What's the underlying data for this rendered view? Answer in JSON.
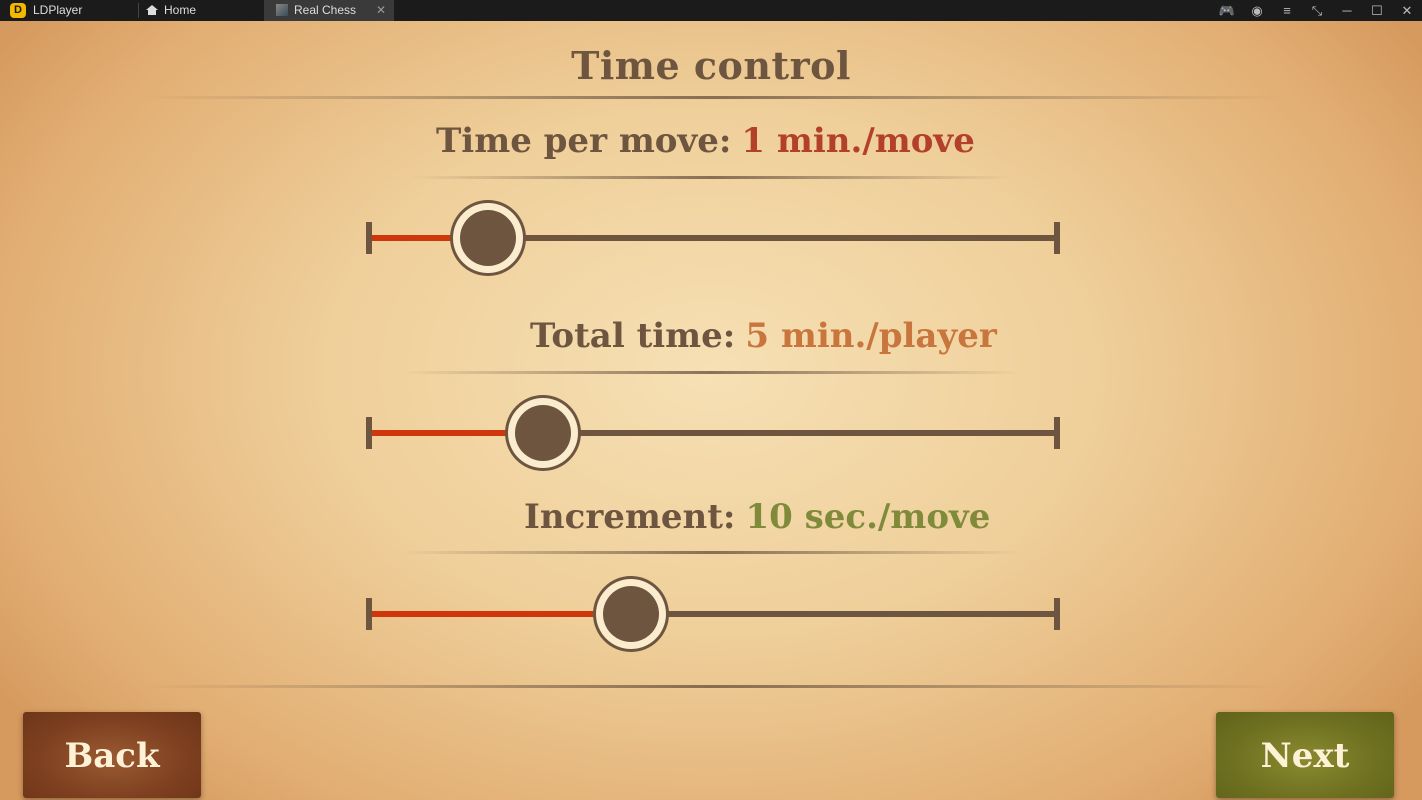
{
  "window": {
    "app_name": "LDPlayer",
    "tabs": [
      {
        "label": "Home",
        "icon": "home-icon"
      },
      {
        "label": "Real Chess",
        "icon": "app-thumbnail-icon",
        "active": true,
        "close_glyph": "✕"
      }
    ],
    "controls": [
      {
        "name": "gamepad-icon",
        "glyph": "🎮"
      },
      {
        "name": "account-icon",
        "glyph": "◉"
      },
      {
        "name": "menu-icon",
        "glyph": "≡"
      },
      {
        "name": "resize-icon",
        "glyph": "⤡"
      },
      {
        "name": "minimize-icon",
        "glyph": "─"
      },
      {
        "name": "maximize-icon",
        "glyph": "☐"
      },
      {
        "name": "close-icon",
        "glyph": "✕"
      }
    ]
  },
  "game": {
    "title": "Time control",
    "settings": [
      {
        "label": "Time per move:",
        "value": "1 min./move",
        "value_color": "#b3402a",
        "slider_fraction": 0.17
      },
      {
        "label": "Total time:",
        "value": "5 min./player",
        "value_color": "#c8763e",
        "slider_fraction": 0.25
      },
      {
        "label": "Increment:",
        "value": "10 sec./move",
        "value_color": "#7f8b3a",
        "slider_fraction": 0.38
      }
    ],
    "back_label": "Back",
    "next_label": "Next"
  }
}
